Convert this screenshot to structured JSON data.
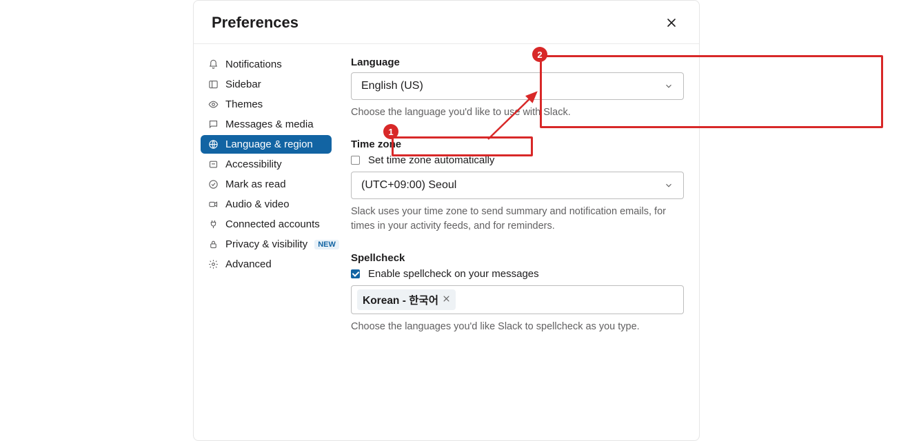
{
  "header": {
    "title": "Preferences"
  },
  "sidebar": {
    "items": [
      {
        "label": "Notifications"
      },
      {
        "label": "Sidebar"
      },
      {
        "label": "Themes"
      },
      {
        "label": "Messages & media"
      },
      {
        "label": "Language & region"
      },
      {
        "label": "Accessibility"
      },
      {
        "label": "Mark as read"
      },
      {
        "label": "Audio & video"
      },
      {
        "label": "Connected accounts"
      },
      {
        "label": "Privacy & visibility",
        "badge": "NEW"
      },
      {
        "label": "Advanced"
      }
    ],
    "activeIndex": 4
  },
  "language": {
    "heading": "Language",
    "value": "English (US)",
    "helper": "Choose the language you'd like to use with Slack."
  },
  "timezone": {
    "heading": "Time zone",
    "autoLabel": "Set time zone automatically",
    "autoChecked": false,
    "value": "(UTC+09:00) Seoul",
    "helper": "Slack uses your time zone to send summary and notification emails, for times in your activity feeds, and for reminders."
  },
  "spellcheck": {
    "heading": "Spellcheck",
    "enableLabel": "Enable spellcheck on your messages",
    "enableChecked": true,
    "chip": "Korean - 한국어",
    "helper": "Choose the languages you'd like Slack to spellcheck as you type."
  },
  "annotations": {
    "n1": "1",
    "n2": "2"
  }
}
